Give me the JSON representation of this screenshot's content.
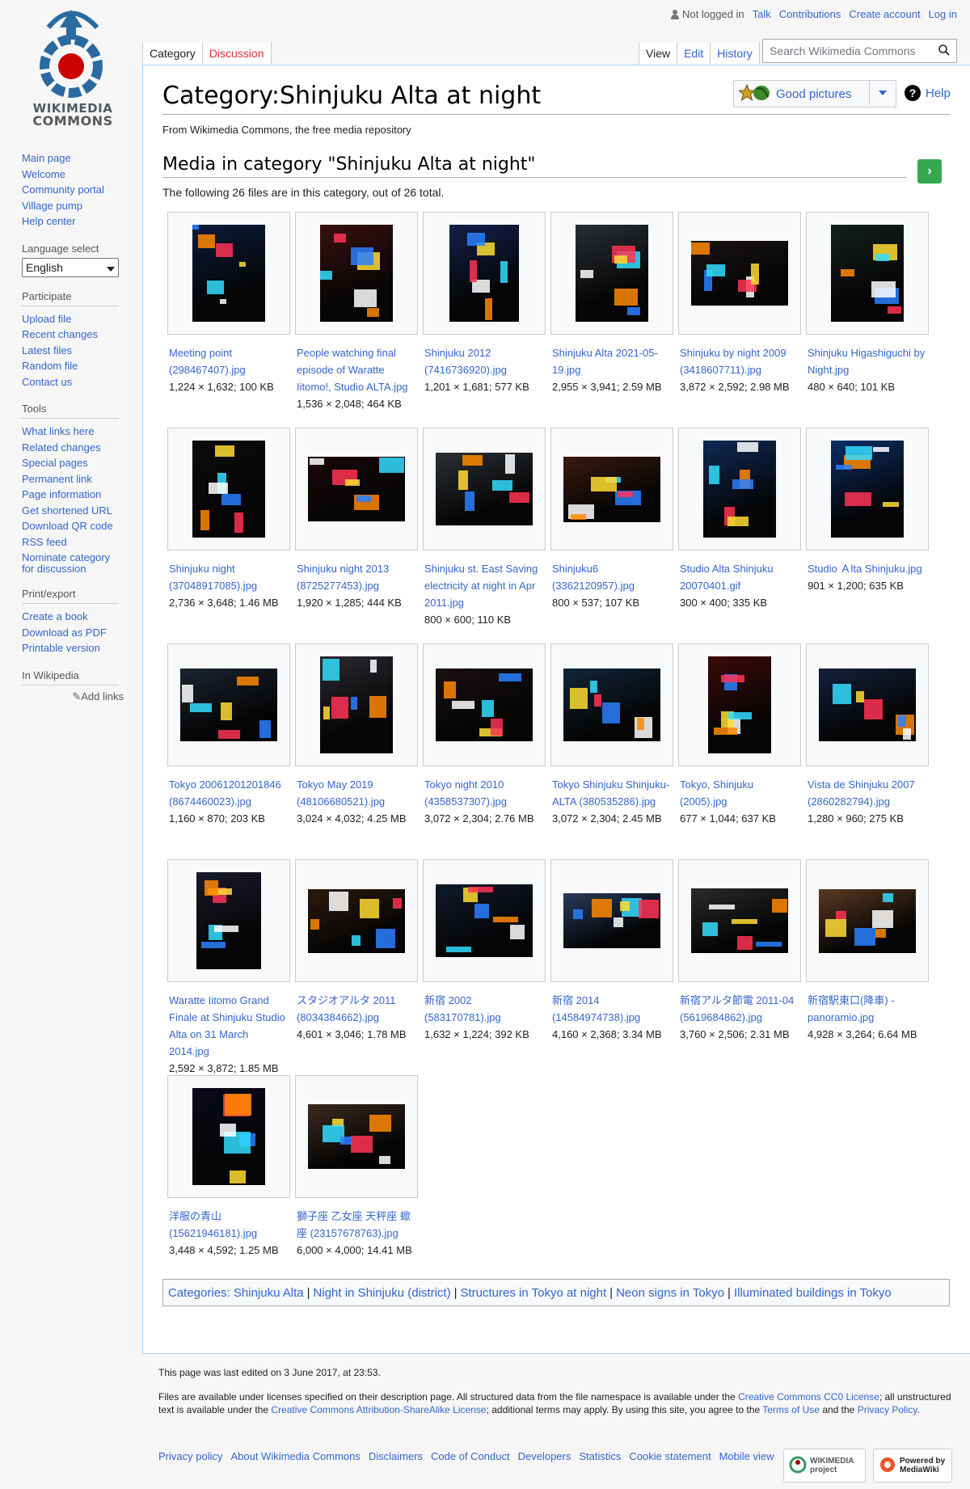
{
  "personal": {
    "not_logged_in": "Not logged in",
    "talk": "Talk",
    "contributions": "Contributions",
    "create_account": "Create account",
    "log_in": "Log in"
  },
  "logo": {
    "line1": "WIKIMEDIA",
    "line2": "COMMONS"
  },
  "sidebar": {
    "nav": [
      "Main page",
      "Welcome",
      "Community portal",
      "Village pump",
      "Help center"
    ],
    "language_select_title": "Language select",
    "language_value": "English",
    "participate_title": "Participate",
    "participate": [
      "Upload file",
      "Recent changes",
      "Latest files",
      "Random file",
      "Contact us"
    ],
    "tools_title": "Tools",
    "tools": [
      "What links here",
      "Related changes",
      "Special pages",
      "Permanent link",
      "Page information",
      "Get shortened URL",
      "Download QR code",
      "RSS feed",
      "Nominate category for discussion"
    ],
    "print_title": "Print/export",
    "print": [
      "Create a book",
      "Download as PDF",
      "Printable version"
    ],
    "wiki_title": "In Wikipedia",
    "add_links": "Add links"
  },
  "tabs": {
    "category": "Category",
    "discussion": "Discussion",
    "view": "View",
    "edit": "Edit",
    "history": "History"
  },
  "search": {
    "placeholder": "Search Wikimedia Commons"
  },
  "page": {
    "title": "Category:Shinjuku Alta at night",
    "site_sub": "From Wikimedia Commons, the free media repository",
    "good_pictures": "Good pictures",
    "help": "Help",
    "media_heading": "Media in category \"Shinjuku Alta at night\"",
    "count_line": "The following 26 files are in this category, out of 26 total."
  },
  "files": [
    {
      "name": "Meeting point (298467407).jpg",
      "meta": "1,224 × 1,632; 100 KB",
      "w": 1224,
      "h": 1632,
      "tone": "#0b1b3a"
    },
    {
      "name": "People watching final episode of Waratte Iitomo!, Studio ALTA.jpg",
      "meta": "1,536 × 2,048; 464 KB",
      "w": 1536,
      "h": 2048,
      "tone": "#3a1010"
    },
    {
      "name": "Shinjuku 2012 (7416736920).jpg",
      "meta": "1,201 × 1,681; 577 KB",
      "w": 1201,
      "h": 1681,
      "tone": "#13204a"
    },
    {
      "name": "Shinjuku Alta 2021-05-19.jpg",
      "meta": "2,955 × 3,941; 2.59 MB",
      "w": 2955,
      "h": 3941,
      "tone": "#2a2e33"
    },
    {
      "name": "Shinjuku by night 2009 (3418607711).jpg",
      "meta": "3,872 × 2,592; 2.98 MB",
      "w": 3872,
      "h": 2592,
      "tone": "#1a1414"
    },
    {
      "name": "Shinjuku Higashiguchi by Night.jpg",
      "meta": "480 × 640; 101 KB",
      "w": 480,
      "h": 640,
      "tone": "#15201a"
    },
    {
      "name": "Shinjuku night (37048917085).jpg",
      "meta": "2,736 × 3,648; 1.46 MB",
      "w": 2736,
      "h": 3648,
      "tone": "#0c0c0c"
    },
    {
      "name": "Shinjuku night 2013 (8725277453).jpg",
      "meta": "1,920 × 1,285; 444 KB",
      "w": 1920,
      "h": 1285,
      "tone": "#1a0808"
    },
    {
      "name": "Shinjuku st. East Saving electricity at night in Apr 2011.jpg",
      "meta": "800 × 600; 110 KB",
      "w": 800,
      "h": 600,
      "tone": "#2b3036"
    },
    {
      "name": "Shinjuku6 (3362120957).jpg",
      "meta": "800 × 537; 107 KB",
      "w": 800,
      "h": 537,
      "tone": "#3a1a10"
    },
    {
      "name": "Studio Alta Shinjuku 20070401.gif",
      "meta": "300 × 400; 335 KB",
      "w": 300,
      "h": 400,
      "tone": "#0e2a55"
    },
    {
      "name": "Studio Ａlta Shinjuku.jpg",
      "meta": "901 × 1,200; 635 KB",
      "w": 901,
      "h": 1200,
      "tone": "#0a2e66"
    },
    {
      "name": "Tokyo 20061201201846 (8674460023).jpg",
      "meta": "1,160 × 870; 203 KB",
      "w": 1160,
      "h": 870,
      "tone": "#1c2430"
    },
    {
      "name": "Tokyo May 2019 (48106680521).jpg",
      "meta": "3,024 × 4,032; 4.25 MB",
      "w": 3024,
      "h": 4032,
      "tone": "#2a2a30"
    },
    {
      "name": "Tokyo night 2010 (4358537307).jpg",
      "meta": "3,072 × 2,304; 2.76 MB",
      "w": 3072,
      "h": 2304,
      "tone": "#1a1010"
    },
    {
      "name": "Tokyo Shinjuku Shinjuku-ALTA (380535286).jpg",
      "meta": "3,072 × 2,304; 2.45 MB",
      "w": 3072,
      "h": 2304,
      "tone": "#10263a"
    },
    {
      "name": "Tokyo, Shinjuku (2005).jpg",
      "meta": "677 × 1,044; 637 KB",
      "w": 677,
      "h": 1044,
      "tone": "#3a0a0a"
    },
    {
      "name": "Vista de Shinjuku 2007 (2860282794).jpg",
      "meta": "1,280 × 960; 275 KB",
      "w": 1280,
      "h": 960,
      "tone": "#15203a"
    },
    {
      "name": "Waratte Iitomo Grand Finale at Shinjuku Studio Alta on 31 March 2014.jpg",
      "meta": "2,592 × 3,872; 1.85 MB",
      "w": 2592,
      "h": 3872,
      "tone": "#1a1a2a"
    },
    {
      "name": "スタジオアルタ 2011 (8034384662).jpg",
      "meta": "4,601 × 3,046; 1.78 MB",
      "w": 4601,
      "h": 3046,
      "tone": "#2a1a10"
    },
    {
      "name": "新宿 2002 (583170781).jpg",
      "meta": "1,632 × 1,224; 392 KB",
      "w": 1632,
      "h": 1224,
      "tone": "#101a2a"
    },
    {
      "name": "新宿 2014 (14584974738).jpg",
      "meta": "4,160 × 2,368; 3.34 MB",
      "w": 4160,
      "h": 2368,
      "tone": "#2a3a5a"
    },
    {
      "name": "新宿アルタ節電 2011-04 (5619684862).jpg",
      "meta": "3,760 × 2,506; 2.31 MB",
      "w": 3760,
      "h": 2506,
      "tone": "#2a2a28"
    },
    {
      "name": "新宿駅東口(降車) - panoramio.jpg",
      "meta": "4,928 × 3,264; 6.64 MB",
      "w": 4928,
      "h": 3264,
      "tone": "#5a3a20"
    },
    {
      "name": "洋服の青山 (15621946181).jpg",
      "meta": "3,448 × 4,592; 1.25 MB",
      "w": 3448,
      "h": 4592,
      "tone": "#0a0a1a"
    },
    {
      "name": "獅子座 乙女座 天秤座 蠍座 (23157678763).jpg",
      "meta": "6,000 × 4,000; 14.41 MB",
      "w": 6000,
      "h": 4000,
      "tone": "#3a2a20"
    }
  ],
  "categories": {
    "label": "Categories",
    "items": [
      "Shinjuku Alta",
      "Night in Shinjuku (district)",
      "Structures in Tokyo at night",
      "Neon signs in Tokyo",
      "Illuminated buildings in Tokyo"
    ]
  },
  "footer": {
    "last_edited": "This page was last edited on 3 June 2017, at 23:53.",
    "license_a": "Files are available under licenses specified on their description page. All structured data from the file namespace is available under the ",
    "cc0": "Creative Commons CC0 License",
    "license_b": "; all unstructured text is available under the ",
    "ccbysa": "Creative Commons Attribution-ShareAlike License",
    "license_c": "; additional terms may apply. By using this site, you agree to the ",
    "terms": "Terms of Use",
    "license_d": " and the ",
    "privacy": "Privacy Policy",
    "license_e": ".",
    "links": [
      "Privacy policy",
      "About Wikimedia Commons",
      "Disclaimers",
      "Code of Conduct",
      "Developers",
      "Statistics",
      "Cookie statement",
      "Mobile view"
    ],
    "badge_wikimedia": "WIKIMEDIA project",
    "badge_mediawiki": "Powered by MediaWiki"
  }
}
